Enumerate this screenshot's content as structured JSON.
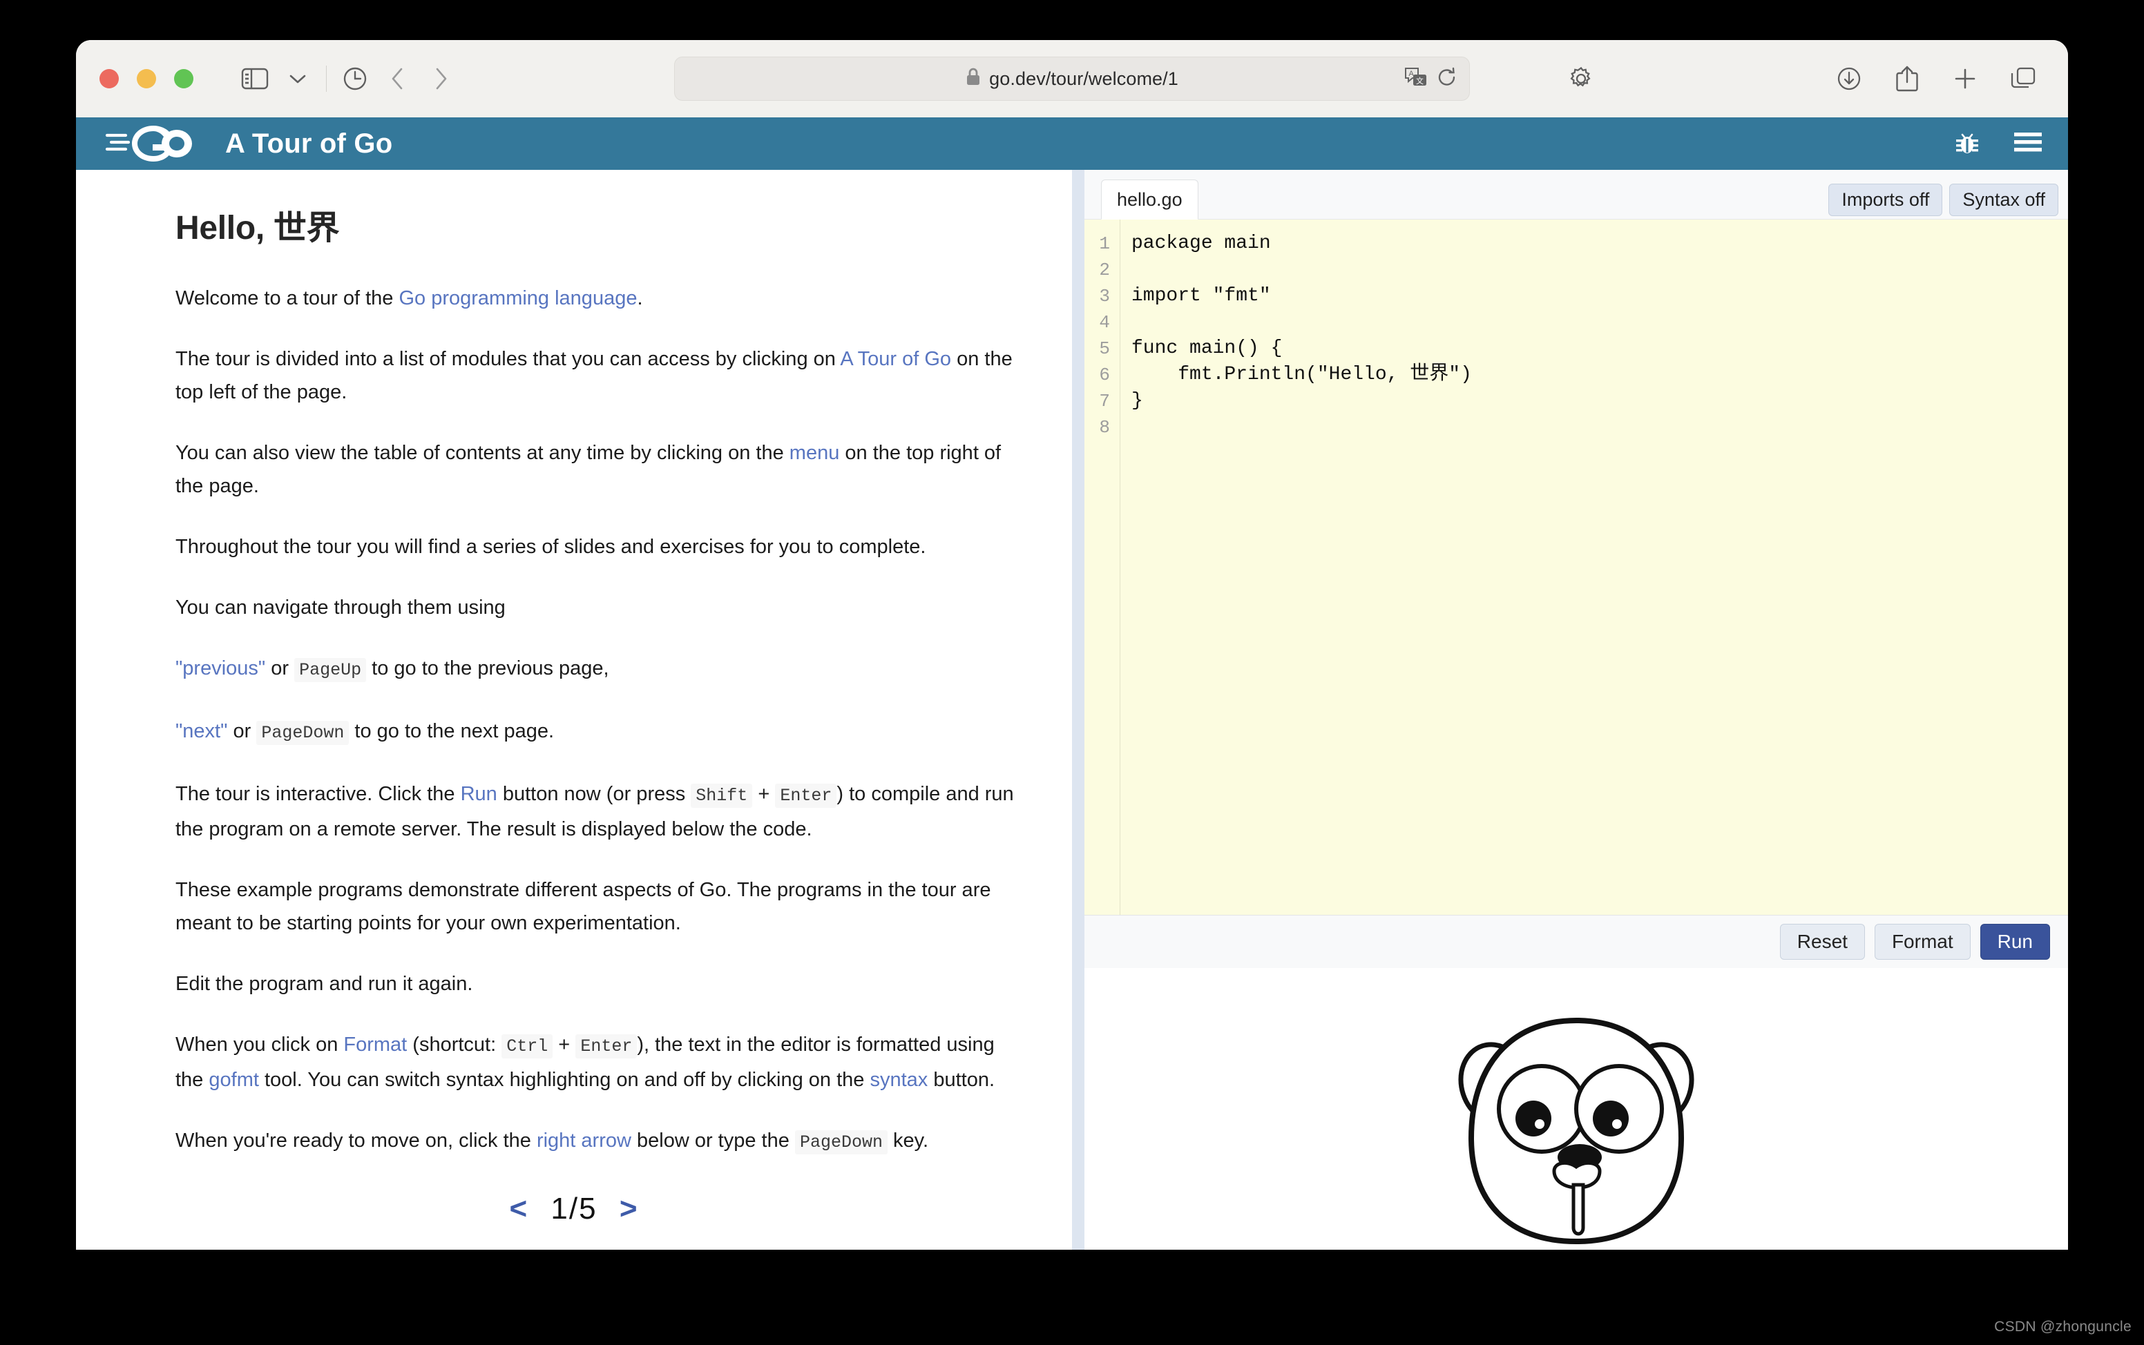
{
  "browser": {
    "url": "go.dev/tour/welcome/1",
    "icons": {
      "sidebar": "sidebar-icon",
      "chevron_down": "chevron-down-icon",
      "history": "history-clock-icon",
      "back": "back-arrow-icon",
      "forward": "forward-arrow-icon",
      "shield": "privacy-shield-icon",
      "lock": "lock-icon",
      "translate": "translate-icon",
      "reload": "reload-icon",
      "extensions": "gear-icon",
      "downloads": "downloads-icon",
      "share": "share-icon",
      "new_tab": "plus-icon",
      "tab_overview": "tab-overview-icon"
    }
  },
  "site_header": {
    "logo_alt": "go-logo",
    "title": "A Tour of Go",
    "bug_icon": "bug-icon",
    "menu_icon": "hamburger-menu-icon"
  },
  "slide": {
    "title": "Hello, 世界",
    "paragraphs": [
      {
        "id": "p1",
        "parts": [
          {
            "t": "text",
            "v": "Welcome to a tour of the "
          },
          {
            "t": "link",
            "v": "Go programming language"
          },
          {
            "t": "text",
            "v": "."
          }
        ]
      },
      {
        "id": "p2",
        "parts": [
          {
            "t": "text",
            "v": "The tour is divided into a list of modules that you can access by clicking on "
          },
          {
            "t": "link",
            "v": "A Tour of Go"
          },
          {
            "t": "text",
            "v": " on the top left of the page."
          }
        ]
      },
      {
        "id": "p3",
        "parts": [
          {
            "t": "text",
            "v": "You can also view the table of contents at any time by clicking on the "
          },
          {
            "t": "link",
            "v": "menu"
          },
          {
            "t": "text",
            "v": " on the top right of the page."
          }
        ]
      },
      {
        "id": "p4",
        "parts": [
          {
            "t": "text",
            "v": "Throughout the tour you will find a series of slides and exercises for you to complete."
          }
        ]
      },
      {
        "id": "p5",
        "parts": [
          {
            "t": "text",
            "v": "You can navigate through them using"
          }
        ]
      }
    ],
    "nav_items": [
      {
        "id": "nav_prev",
        "parts": [
          {
            "t": "link",
            "v": "\"previous\""
          },
          {
            "t": "text",
            "v": " or "
          },
          {
            "t": "code",
            "v": "PageUp"
          },
          {
            "t": "text",
            "v": " to go to the previous page,"
          }
        ]
      },
      {
        "id": "nav_next",
        "parts": [
          {
            "t": "link",
            "v": "\"next\""
          },
          {
            "t": "text",
            "v": " or "
          },
          {
            "t": "code",
            "v": "PageDown"
          },
          {
            "t": "text",
            "v": " to go to the next page."
          }
        ]
      }
    ],
    "paragraphs2": [
      {
        "id": "p6",
        "parts": [
          {
            "t": "text",
            "v": "The tour is interactive. Click the "
          },
          {
            "t": "link",
            "v": "Run"
          },
          {
            "t": "text",
            "v": " button now (or press "
          },
          {
            "t": "code",
            "v": "Shift"
          },
          {
            "t": "text",
            "v": " + "
          },
          {
            "t": "code",
            "v": "Enter"
          },
          {
            "t": "text",
            "v": ") to compile and run the program on a remote server. The result is displayed below the code."
          }
        ]
      },
      {
        "id": "p7",
        "parts": [
          {
            "t": "text",
            "v": "These example programs demonstrate different aspects of Go. The programs in the tour are meant to be starting points for your own experimentation."
          }
        ]
      },
      {
        "id": "p8",
        "parts": [
          {
            "t": "text",
            "v": "Edit the program and run it again."
          }
        ]
      },
      {
        "id": "p9",
        "parts": [
          {
            "t": "text",
            "v": "When you click on "
          },
          {
            "t": "link",
            "v": "Format"
          },
          {
            "t": "text",
            "v": " (shortcut: "
          },
          {
            "t": "code",
            "v": "Ctrl"
          },
          {
            "t": "text",
            "v": " + "
          },
          {
            "t": "code",
            "v": "Enter"
          },
          {
            "t": "text",
            "v": "), the text in the editor is formatted using the "
          },
          {
            "t": "link",
            "v": "gofmt"
          },
          {
            "t": "text",
            "v": " tool. You can switch syntax highlighting on and off by clicking on the "
          },
          {
            "t": "link",
            "v": "syntax"
          },
          {
            "t": "text",
            "v": " button."
          }
        ]
      },
      {
        "id": "p10",
        "parts": [
          {
            "t": "text",
            "v": "When you're ready to move on, click the "
          },
          {
            "t": "link",
            "v": "right arrow"
          },
          {
            "t": "text",
            "v": " below or type the "
          },
          {
            "t": "code",
            "v": "PageDown"
          },
          {
            "t": "text",
            "v": " key."
          }
        ]
      }
    ],
    "pager": {
      "prev": "<",
      "position": "1/5",
      "next": ">"
    }
  },
  "editor": {
    "filename": "hello.go",
    "imports_button": "Imports off",
    "syntax_button": "Syntax off",
    "line_numbers": [
      "1",
      "2",
      "3",
      "4",
      "5",
      "6",
      "7",
      "8"
    ],
    "code": "package main\n\nimport \"fmt\"\n\nfunc main() {\n    fmt.Println(\"Hello, 世界\")\n}\n",
    "buttons": {
      "reset": "Reset",
      "format": "Format",
      "run": "Run"
    }
  },
  "output_pane": {
    "gopher_alt": "go-gopher-mascot"
  },
  "watermark": "CSDN @zhonguncle",
  "colors": {
    "go_header_teal": "#34789a",
    "link_blue": "#5875c0",
    "run_button_blue": "#3a539b",
    "editor_yellow": "#fcfce0",
    "splitter_blue": "#dde5f0",
    "pager_arrow": "#3e5ba9"
  }
}
